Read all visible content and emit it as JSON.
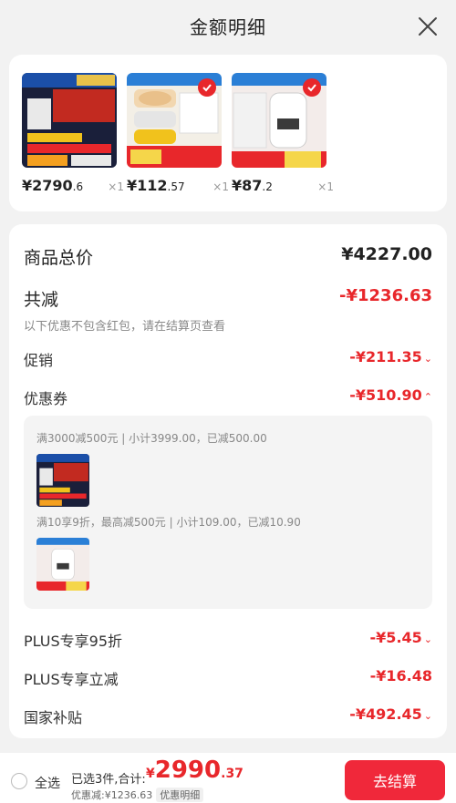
{
  "header": {
    "title": "金额明细"
  },
  "products": [
    {
      "price_int": "¥2790",
      "price_dec": ".6",
      "qty": "×1",
      "checked": false
    },
    {
      "price_int": "¥112",
      "price_dec": ".57",
      "qty": "×1",
      "checked": true
    },
    {
      "price_int": "¥87",
      "price_dec": ".2",
      "qty": "×1",
      "checked": true
    }
  ],
  "summary": {
    "total_label": "商品总价",
    "total_value": "¥4227.00",
    "reduction_label": "共减",
    "reduction_value": "-¥1236.63",
    "reduction_hint": "以下优惠不包含红包，请在结算页查看",
    "promo_label": "促销",
    "promo_value": "-¥211.35",
    "coupon_label": "优惠券",
    "coupon_value": "-¥510.90",
    "coupon_details": [
      "满3000减500元 | 小计3999.00，已减500.00",
      "满10享9折，最高减500元 | 小计109.00，已减10.90"
    ],
    "plus_discount_label": "PLUS专享95折",
    "plus_discount_value": "-¥5.45",
    "plus_direct_label": "PLUS专享立减",
    "plus_direct_value": "-¥16.48",
    "subsidy_label": "国家补贴",
    "subsidy_value": "-¥492.45"
  },
  "bottom_bar": {
    "select_all": "全选",
    "selected_text": "已选3件,合计:",
    "total_yen": "¥",
    "total_int": "2990",
    "total_dec": ".37",
    "discount_text": "优惠减:¥1236.63",
    "detail_tag": "优惠明细",
    "checkout": "去结算"
  },
  "colors": {
    "accent": "#e8272b",
    "checkout_bg": "#f0283a"
  }
}
